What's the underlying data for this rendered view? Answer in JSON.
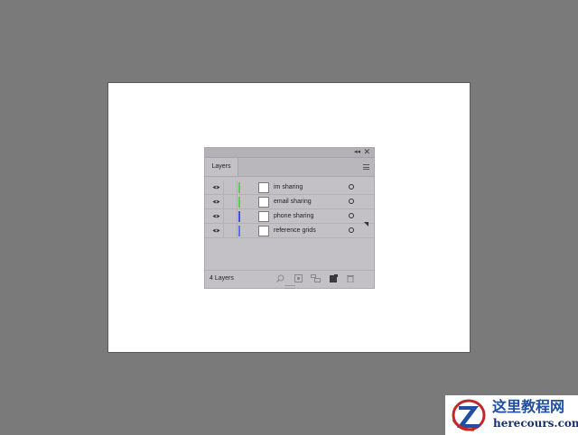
{
  "panel": {
    "tab_label": "Layers",
    "layers": [
      {
        "name": "im sharing",
        "color": "#55cf55"
      },
      {
        "name": "email sharing",
        "color": "#55cf55"
      },
      {
        "name": "phone sharing",
        "color": "#4b4be8"
      },
      {
        "name": "reference grids",
        "color": "#5b72e8"
      }
    ],
    "footer_count": "4 Layers",
    "icons": {
      "collapse": "double-chevron-icon",
      "close": "close-icon",
      "menu": "panel-menu-icon",
      "visibility": "eye-icon",
      "target": "target-circle-icon",
      "footer": [
        "locate-object-icon",
        "make-clipping-mask-icon",
        "create-sublayer-icon",
        "create-new-layer-icon",
        "delete-layer-icon"
      ]
    }
  },
  "watermark": {
    "title": "这里教程网",
    "url": "herecours.com",
    "colors": {
      "title": "#1f4ea3",
      "url": "#1a2f6a",
      "logo_ring": "#c0282a",
      "logo_letter": "#1f4ea3"
    }
  },
  "colors": {
    "workspace": "#7a7a7a",
    "artboard": "#ffffff",
    "panel": "#c3c1c6"
  }
}
